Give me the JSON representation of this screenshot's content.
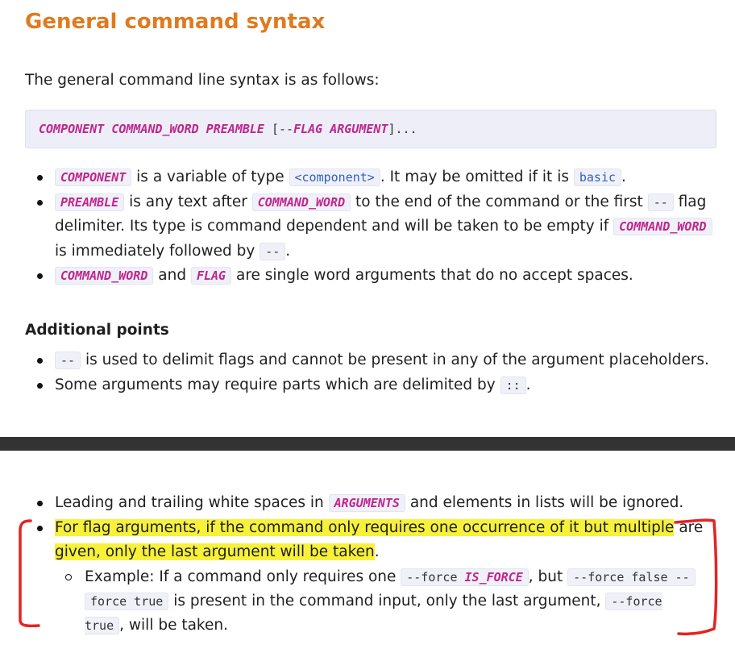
{
  "title": "General command syntax",
  "intro": "The general command line syntax is as follows:",
  "syntax_block": {
    "component": "COMPONENT",
    "command_word": "COMMAND_WORD",
    "preamble": "PREAMBLE",
    "open": "[--",
    "flag": "FLAG",
    "argument": "ARGUMENT",
    "close": "]..."
  },
  "syntax_list": {
    "item1": {
      "code_component": "COMPONENT",
      "text_a": "is a variable of type",
      "code_type": "<component>",
      "text_b": ". It may be omitted if it is",
      "code_basic": "basic",
      "text_c": "."
    },
    "item2": {
      "code_preamble": "PREAMBLE",
      "text_a": "is any text after",
      "code_command_word": "COMMAND_WORD",
      "text_b": "to the end of the command or the first",
      "code_dashes": "--",
      "text_c": "flag delimiter. Its type is command dependent and will be taken to be empty if",
      "code_command_word2": "COMMAND_WORD",
      "text_d": "is immediately followed by",
      "code_dashes2": "--",
      "text_e": "."
    },
    "item3": {
      "code_command_word": "COMMAND_WORD",
      "text_a": "and",
      "code_flag": "FLAG",
      "text_b": "are single word arguments that do no accept spaces."
    }
  },
  "additional": {
    "heading": "Additional points",
    "item1": {
      "code": "--",
      "text": "is used to delimit flags and cannot be present in any of the argument placeholders."
    },
    "item2": {
      "text": "Some arguments may require parts which are delimited by",
      "code": "::",
      "end": "."
    }
  },
  "lower": {
    "item1": {
      "text_a": "Leading and trailing white spaces in",
      "code": "ARGUMENTS",
      "text_b": "and elements in lists will be ignored."
    },
    "item2": {
      "highlight_a": "For flag arguments, if the command only requires one occurrence of it but multiple",
      "text_a": "are",
      "highlight_b": "given, only the last argument will be taken",
      "text_b": ".",
      "sub": {
        "text_a": "Example: If a command only requires one",
        "code1_a": "--force",
        "code1_b": "IS_FORCE",
        "text_b": ", but",
        "code2": "--force false --",
        "code3": "force true",
        "text_c": "is present in the command input, only the last argument,",
        "code4": "--force true",
        "text_d": ",",
        "text_e": "will be taken."
      }
    }
  },
  "annotation": {
    "bracket_color": "#e52222",
    "highlight_color": "#f7f13a"
  }
}
